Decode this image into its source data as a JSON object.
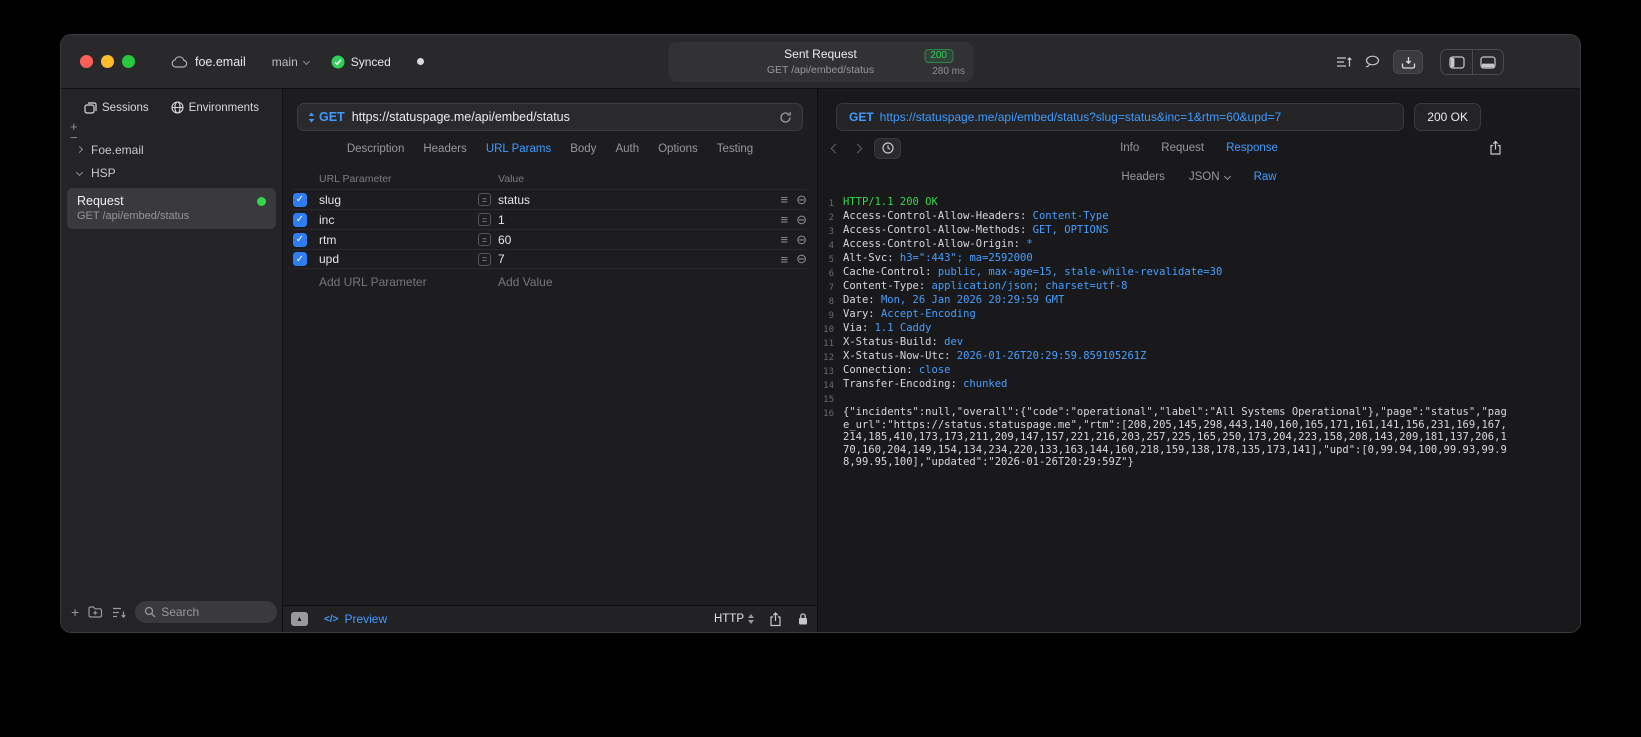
{
  "colors": {
    "accent": "#3f9bff",
    "success": "#30d158",
    "value_blue": "#459fff",
    "checkbox_blue": "#2f7cf7"
  },
  "icons": {
    "check": "✓",
    "reorder": "≡",
    "remove": "⊖",
    "collapse": "▲",
    "plus": "+",
    "minus": "−"
  },
  "titlebar": {
    "project": "foe.email",
    "branch": "main",
    "sync_status": "Synced",
    "request": {
      "title": "Sent Request",
      "status_code": "200",
      "subtitle": "GET /api/embed/status",
      "duration": "280 ms"
    }
  },
  "sidebar": {
    "tabs": [
      {
        "label": "Sessions",
        "active": true
      },
      {
        "label": "Environments",
        "active": false
      }
    ],
    "tree": [
      {
        "label": "Foe.email",
        "expanded": false
      },
      {
        "label": "HSP",
        "expanded": true
      }
    ],
    "request_item": {
      "title": "Request",
      "subtitle": "GET /api/embed/status"
    },
    "search_placeholder": "Search"
  },
  "request_pane": {
    "method": "GET",
    "url": "https://statuspage.me/api/embed/status",
    "tabs": [
      "Description",
      "Headers",
      "URL Params",
      "Body",
      "Auth",
      "Options",
      "Testing"
    ],
    "active_tab": "URL Params",
    "table": {
      "col_param": "URL Parameter",
      "col_value": "Value",
      "rows": [
        {
          "name": "slug",
          "value": "status",
          "checked": true
        },
        {
          "name": "inc",
          "value": "1",
          "checked": true
        },
        {
          "name": "rtm",
          "value": "60",
          "checked": true
        },
        {
          "name": "upd",
          "value": "7",
          "checked": true
        }
      ],
      "add_param": "Add URL Parameter",
      "add_value": "Add Value"
    },
    "footer": {
      "code_glyph": "</>",
      "preview": "Preview",
      "protocol": "HTTP"
    }
  },
  "response_pane": {
    "method": "GET",
    "url": "https://statuspage.me/api/embed/status?slug=status&inc=1&rtm=60&upd=7",
    "status": "200 OK",
    "tabs": [
      "Info",
      "Request",
      "Response"
    ],
    "active_tab": "Response",
    "subtabs": [
      "Headers",
      "JSON",
      "Raw"
    ],
    "active_subtab": "Raw",
    "lines": [
      {
        "n": "1",
        "parts": [
          {
            "text": "HTTP/1.1 200 OK",
            "color": "status"
          }
        ]
      },
      {
        "n": "2",
        "parts": [
          {
            "text": "Access-Control-Allow-Headers: ",
            "color": "name"
          },
          {
            "text": "Content-Type",
            "color": "value"
          }
        ]
      },
      {
        "n": "3",
        "parts": [
          {
            "text": "Access-Control-Allow-Methods: ",
            "color": "name"
          },
          {
            "text": "GET, OPTIONS",
            "color": "value"
          }
        ]
      },
      {
        "n": "4",
        "parts": [
          {
            "text": "Access-Control-Allow-Origin: ",
            "color": "name"
          },
          {
            "text": "*",
            "color": "value"
          }
        ]
      },
      {
        "n": "5",
        "parts": [
          {
            "text": "Alt-Svc: ",
            "color": "name"
          },
          {
            "text": "h3=\":443\"; ma=2592000",
            "color": "value"
          }
        ]
      },
      {
        "n": "6",
        "parts": [
          {
            "text": "Cache-Control: ",
            "color": "name"
          },
          {
            "text": "public, max-age=15, stale-while-revalidate=30",
            "color": "value"
          }
        ]
      },
      {
        "n": "7",
        "parts": [
          {
            "text": "Content-Type: ",
            "color": "name"
          },
          {
            "text": "application/json; charset=utf-8",
            "color": "value"
          }
        ]
      },
      {
        "n": "8",
        "parts": [
          {
            "text": "Date: ",
            "color": "name"
          },
          {
            "text": "Mon, 26 Jan 2026 20:29:59 GMT",
            "color": "value"
          }
        ]
      },
      {
        "n": "9",
        "parts": [
          {
            "text": "Vary: ",
            "color": "name"
          },
          {
            "text": "Accept-Encoding",
            "color": "value"
          }
        ]
      },
      {
        "n": "10",
        "parts": [
          {
            "text": "Via: ",
            "color": "name"
          },
          {
            "text": "1.1 Caddy",
            "color": "value"
          }
        ]
      },
      {
        "n": "11",
        "parts": [
          {
            "text": "X-Status-Build: ",
            "color": "name"
          },
          {
            "text": "dev",
            "color": "value"
          }
        ]
      },
      {
        "n": "12",
        "parts": [
          {
            "text": "X-Status-Now-Utc: ",
            "color": "name"
          },
          {
            "text": "2026-01-26T20:29:59.859105261Z",
            "color": "value"
          }
        ]
      },
      {
        "n": "13",
        "parts": [
          {
            "text": "Connection: ",
            "color": "name"
          },
          {
            "text": "close",
            "color": "value"
          }
        ]
      },
      {
        "n": "14",
        "parts": [
          {
            "text": "Transfer-Encoding: ",
            "color": "name"
          },
          {
            "text": "chunked",
            "color": "value"
          }
        ]
      },
      {
        "n": "15",
        "parts": []
      },
      {
        "n": "16",
        "parts": [
          {
            "text": "{\"incidents\":null,\"overall\":{\"code\":\"operational\",\"label\":\"All Systems Operational\"},\"page\":\"status\",\"page_url\":\"https://status.statuspage.me\",\"rtm\":[208,205,145,298,443,140,160,165,171,161,141,156,231,169,167,214,185,410,173,173,211,209,147,157,221,216,203,257,225,165,250,173,204,223,158,208,143,209,181,137,206,170,160,204,149,154,134,234,220,133,163,144,160,218,159,138,178,135,173,141],\"upd\":[0,99.94,100,99.93,99.98,99.95,100],\"updated\":\"2026-01-26T20:29:59Z\"}",
            "color": "body"
          }
        ]
      }
    ]
  }
}
